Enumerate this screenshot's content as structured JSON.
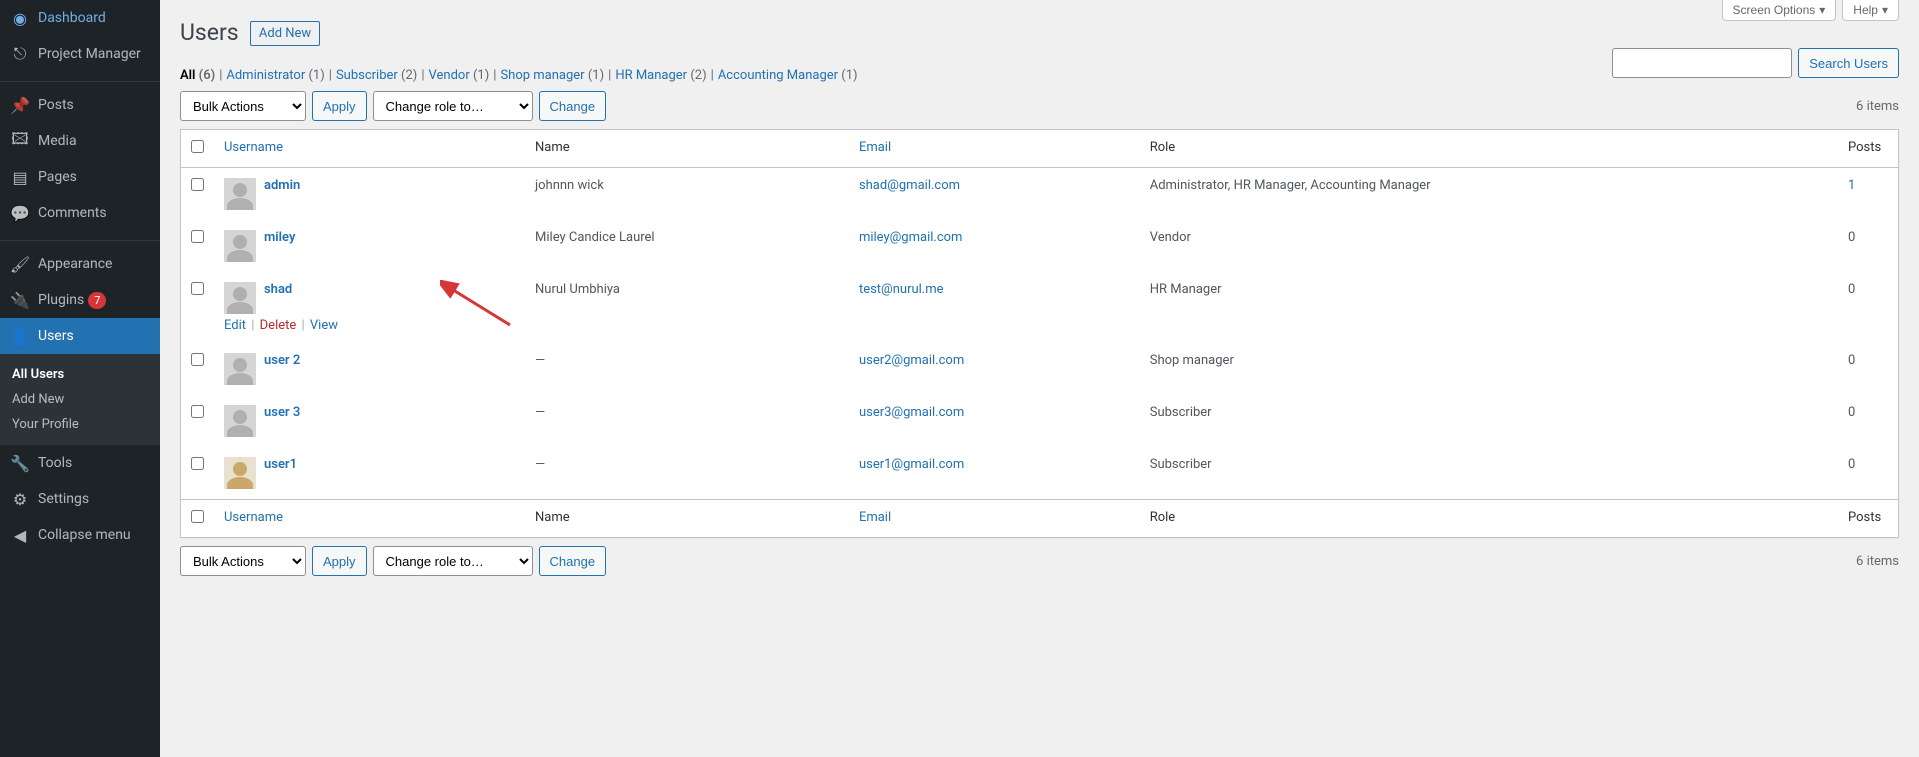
{
  "sidebar": {
    "items": [
      {
        "key": "dashboard",
        "icon": "dashboard-icon",
        "label": "Dashboard"
      },
      {
        "key": "project-manager",
        "icon": "project-icon",
        "label": "Project Manager"
      },
      {
        "key": "sep1",
        "sep": true
      },
      {
        "key": "posts",
        "icon": "pin-icon",
        "label": "Posts"
      },
      {
        "key": "media",
        "icon": "media-icon",
        "label": "Media"
      },
      {
        "key": "pages",
        "icon": "pages-icon",
        "label": "Pages"
      },
      {
        "key": "comments",
        "icon": "comment-icon",
        "label": "Comments"
      },
      {
        "key": "sep2",
        "sep": true
      },
      {
        "key": "appearance",
        "icon": "brush-icon",
        "label": "Appearance"
      },
      {
        "key": "plugins",
        "icon": "plugin-icon",
        "label": "Plugins",
        "badge": "7"
      },
      {
        "key": "users",
        "icon": "user-icon",
        "label": "Users",
        "current": true
      },
      {
        "key": "tools",
        "icon": "wrench-icon",
        "label": "Tools"
      },
      {
        "key": "settings",
        "icon": "settings-icon",
        "label": "Settings"
      },
      {
        "key": "collapse",
        "icon": "collapse-icon",
        "label": "Collapse menu"
      }
    ],
    "submenu_after": "users",
    "submenu": [
      {
        "label": "All Users",
        "current": true
      },
      {
        "label": "Add New"
      },
      {
        "label": "Your Profile"
      }
    ]
  },
  "screen_meta": {
    "screen_options": "Screen Options",
    "help": "Help"
  },
  "page": {
    "title": "Users",
    "add_new": "Add New"
  },
  "filters": {
    "links": [
      {
        "label": "All",
        "count": "(6)",
        "current": true
      },
      {
        "label": "Administrator",
        "count": "(1)"
      },
      {
        "label": "Subscriber",
        "count": "(2)"
      },
      {
        "label": "Vendor",
        "count": "(1)"
      },
      {
        "label": "Shop manager",
        "count": "(1)"
      },
      {
        "label": "HR Manager",
        "count": "(2)"
      },
      {
        "label": "Accounting Manager",
        "count": "(1)"
      }
    ]
  },
  "bulk": {
    "bulk_actions": "Bulk Actions",
    "apply": "Apply",
    "change_role": "Change role to…",
    "change": "Change"
  },
  "search": {
    "placeholder": "",
    "button": "Search Users"
  },
  "count_text": "6 items",
  "columns": {
    "username": "Username",
    "name": "Name",
    "email": "Email",
    "role": "Role",
    "posts": "Posts"
  },
  "row_actions": {
    "edit": "Edit",
    "delete": "Delete",
    "view": "View"
  },
  "users": [
    {
      "username": "admin",
      "name": "johnnn wick",
      "email": "shad@gmail.com",
      "role": "Administrator, HR Manager, Accounting Manager",
      "posts": "1",
      "posts_link": true
    },
    {
      "username": "miley",
      "name": "Miley Candice Laurel",
      "email": "miley@gmail.com",
      "role": "Vendor",
      "posts": "0"
    },
    {
      "username": "shad",
      "name": "Nurul Umbhiya",
      "email": "test@nurul.me",
      "role": "HR Manager",
      "posts": "0",
      "show_actions": true
    },
    {
      "username": "user 2",
      "name": "—",
      "email": "user2@gmail.com",
      "role": "Shop manager",
      "posts": "0"
    },
    {
      "username": "user 3",
      "name": "—",
      "email": "user3@gmail.com",
      "role": "Subscriber",
      "posts": "0"
    },
    {
      "username": "user1",
      "name": "—",
      "email": "user1@gmail.com",
      "role": "Subscriber",
      "posts": "0",
      "avatar_class": "wooden"
    }
  ],
  "icons": {
    "dashboard-icon": "◉",
    "project-icon": "⎋",
    "pin-icon": "📌",
    "media-icon": "🖾",
    "pages-icon": "▤",
    "comment-icon": "💬",
    "brush-icon": "🖌",
    "plugin-icon": "🔌",
    "user-icon": "👤",
    "wrench-icon": "🔧",
    "settings-icon": "⚙",
    "collapse-icon": "◀"
  }
}
